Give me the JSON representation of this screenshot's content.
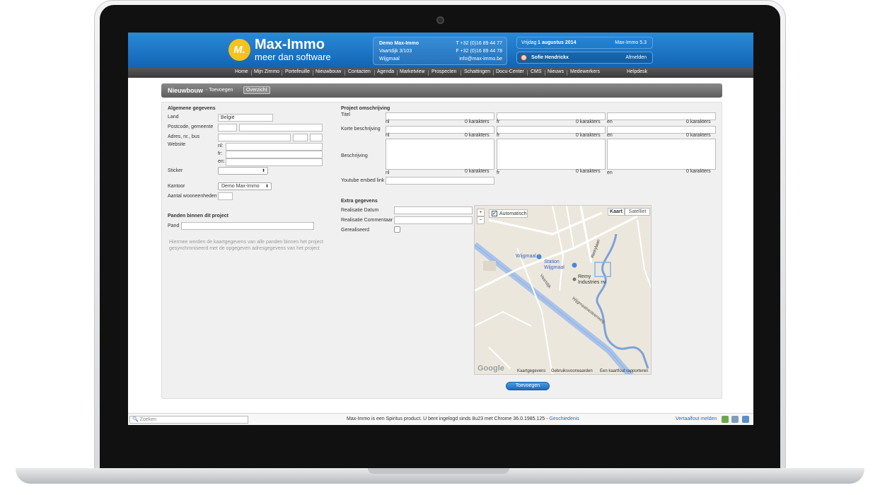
{
  "header": {
    "logo_letter": "M.",
    "brand": "Max-Immo",
    "tagline": "meer dan software",
    "company": "Demo Max-Immo",
    "street": "Vaartdijk 3/103",
    "city": "Wijgmaal",
    "phone": "T +32 (0)16 89 44 77",
    "fax": "F +32 (0)16 89 44 78",
    "email": "info@max-immo.be",
    "day": "Vrijdag",
    "date": "1 augustus 2014",
    "version": "Max-Immo 5.3",
    "user": "Sofie Hendrickx",
    "logout": "Afmelden"
  },
  "nav": {
    "items": [
      "Home",
      "Mijn Zimmo",
      "Portefeuille",
      "Nieuwbouw",
      "Contacten",
      "Agenda",
      "Marketview",
      "Prospecten",
      "Schattingen",
      "Docu-Center",
      "CMS",
      "Nieuws",
      "Medewerkers"
    ],
    "help": "Helpdesk"
  },
  "page": {
    "title": "Nieuwbouw",
    "subtitle": "- Toevoegen",
    "overview_button": "Overzicht"
  },
  "general": {
    "heading": "Algemene gegevens",
    "land_label": "Land",
    "land_value": "België",
    "postcode_label": "Postcode, gemeente",
    "address_label": "Adres, nr., bus",
    "website_label": "Website",
    "lang_nl": "nl:",
    "lang_fr": "fr:",
    "lang_en": "en:",
    "sticker_label": "Sticker",
    "office_label": "Kantoor",
    "office_value": "Demo Max-Immo",
    "units_label": "Aantal wooneenheden"
  },
  "panden": {
    "heading": "Panden binnen dit project",
    "pand_label": "Pand",
    "note_line1": "Hiermee worden de kaartgegevens van alle panden binnen het project",
    "note_line2": "gesynchroniseerd met de opgegeven adresgegevens van het project"
  },
  "description": {
    "heading": "Project omschrijving",
    "title_label": "Titel",
    "short_label": "Korte beschrijving",
    "desc_label": "Beschrijving",
    "youtube_label": "Youtube embed link",
    "langs": [
      "nl",
      "fr",
      "en"
    ],
    "counter": "0 karakters"
  },
  "extra": {
    "heading": "Extra gegevens",
    "date_label": "Realisatie Datum",
    "comment_label": "Realisatie Commentaar",
    "realised_label": "Gerealiseerd"
  },
  "map": {
    "auto_label": "Automatisch",
    "map_tab": "Kaart",
    "sat_tab": "Satelliet",
    "zoom_in": "+",
    "zoom_out": "−",
    "place_wijgmaal": "Wijgmaal",
    "place_station": "Station Wijgmaal",
    "place_remy": "Remy Industries nv",
    "street_remy": "Remylaan",
    "street_vaartdijk": "Vaartdijk",
    "street_steenweg": "Wijgmaalsesteenweg",
    "google": "Google",
    "attr1": "Kaartgegevens",
    "attr2": "Gebruiksvoorwaarden",
    "attr3": "Een kaartfout rapporteren"
  },
  "actions": {
    "submit": "Toevoegen"
  },
  "footer": {
    "search_placeholder": "Zoeken",
    "status": "Max-Immo is een Spiritus product. U bent ingelogd sinds 8u23 met Chrome 36.0.1985.125 - ",
    "history": "Geschiedenis",
    "translate": "Vertaalfout melden"
  },
  "colors": {
    "header_blue": "#1a72c4",
    "accent_yellow": "#f7c21a",
    "link_blue": "#1a6fc4"
  }
}
